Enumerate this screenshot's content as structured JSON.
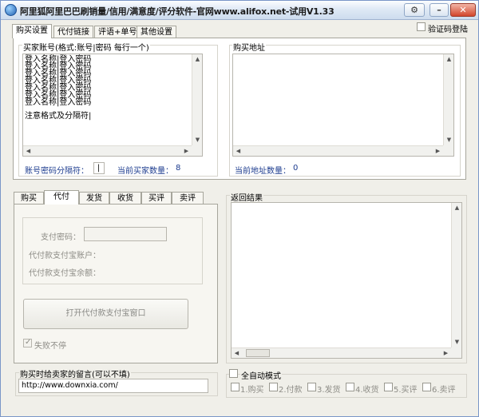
{
  "window": {
    "title": "阿里狐阿里巴巴刷销量/信用/满意度/评分软件-官网www.alifox.net-试用V1.33",
    "gear": "⚙",
    "minimize": "–",
    "close": "✕"
  },
  "top_tabs": [
    "购买设置",
    "代付链接",
    "评语+单号",
    "其他设置"
  ],
  "verify_login": "验证码登陆",
  "buyer": {
    "label": "买家账号(格式:账号|密码 每行一个)",
    "lines": [
      "登入名称|登入密码",
      "登入名称|登入密码",
      "登入名称|登入密码",
      "登入名称|登入密码",
      "登入名称|登入密码",
      "登入名称|登入密码",
      "登入名称|登入密码"
    ],
    "note": "注意格式及分隔符|",
    "separator_label": "账号密码分隔符：",
    "separator_value": "|",
    "count_label": "当前买家数量：",
    "count_value": "8"
  },
  "address": {
    "label": "购买地址",
    "count_label": "当前地址数量：",
    "count_value": "0"
  },
  "sub_tabs": [
    "购买",
    "代付",
    "发货",
    "收货",
    "买评",
    "卖评"
  ],
  "pay": {
    "password_label": "支付密码：",
    "account_label": "代付款支付宝账户：",
    "balance_label": "代付款支付宝余额：",
    "open_button": "打开代付款支付宝窗口",
    "fail_continue": "失败不停",
    "fail_checked": "✓"
  },
  "results": {
    "label": "返回结果"
  },
  "message": {
    "label": "购买时给卖家的留言(可以不填)",
    "value": "http://www.downxia.com/"
  },
  "auto": {
    "label": "全自动模式",
    "steps": [
      "1.购买",
      "2.付款",
      "3.发货",
      "4.收货",
      "5.买评",
      "6.卖评"
    ]
  }
}
